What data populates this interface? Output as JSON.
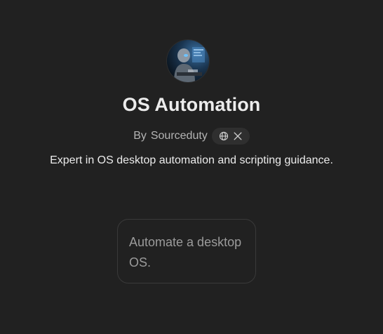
{
  "gpt": {
    "avatar_icon": "robot-at-computer-avatar",
    "title": "OS Automation",
    "author_prefix": "By",
    "author": "Sourceduty",
    "social": {
      "website_icon": "globe-icon",
      "x_icon": "x-logo-icon"
    },
    "description": "Expert in OS desktop automation and scripting guidance."
  },
  "conversation_starters": [
    {
      "text": "Automate a desktop OS."
    }
  ],
  "colors": {
    "background": "#212121",
    "title": "#ececec",
    "muted": "#b4b4b4",
    "pill": "#2f2f2f",
    "card_border": "#3a3a3a",
    "card_text": "#9b9b9b"
  }
}
